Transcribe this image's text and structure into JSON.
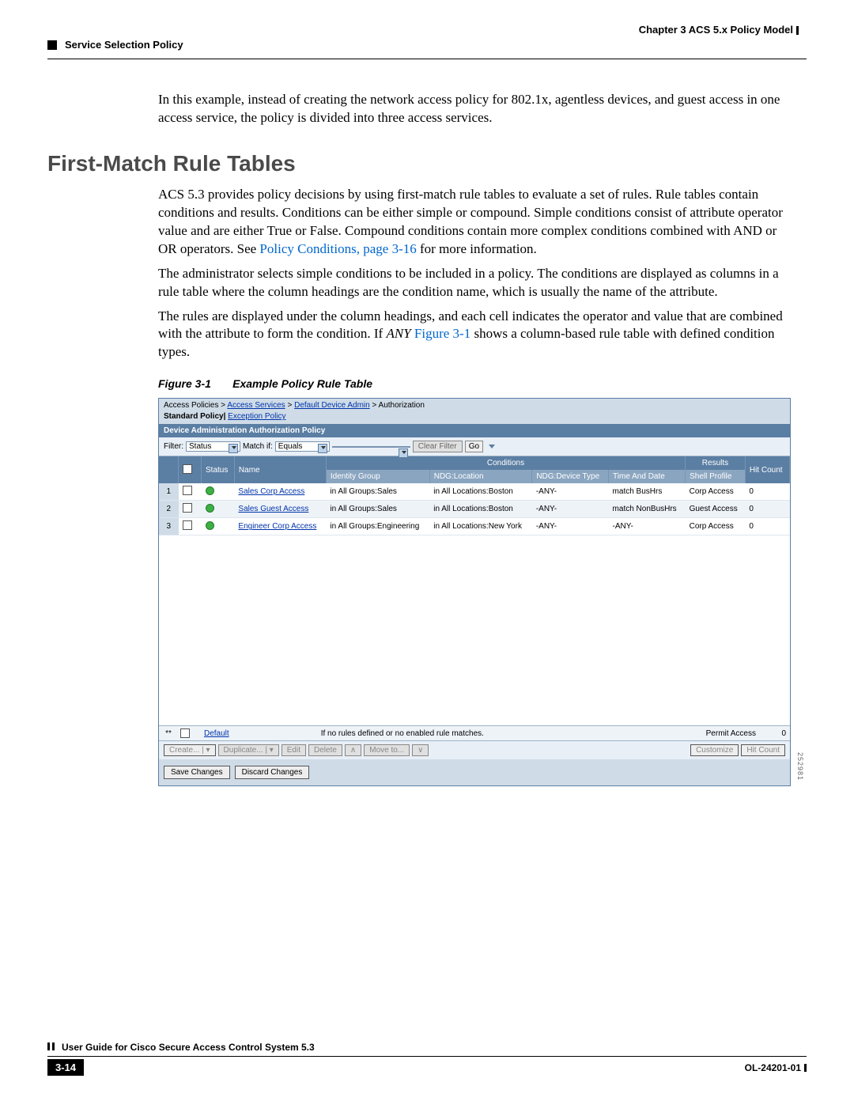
{
  "header": {
    "chapter": "Chapter 3    ACS 5.x Policy Model",
    "section": "Service Selection Policy"
  },
  "body": {
    "intro_para": "In this example, instead of creating the network access policy for 802.1x, agentless devices, and guest access in one access service, the policy is divided into three access services.",
    "h2": "First-Match Rule Tables",
    "p1a": "ACS 5.3 provides policy decisions by using first-match rule tables to evaluate a set of rules. Rule tables contain conditions and results. Conditions can be either simple or compound. Simple conditions consist of attribute operator value and are either True or False. Compound conditions contain more complex conditions combined with AND or OR operators. See ",
    "p1_link": "Policy Conditions, page 3-16",
    "p1b": " for more information.",
    "p2": "The administrator selects simple conditions to be included in a policy. The conditions are displayed as columns in a rule table where the column headings are the condition name, which is usually the name of the attribute.",
    "p3a": "The rules are displayed under the column headings, and each cell indicates the operator and value that are combined with the attribute to form the condition. If ",
    "p3_any": "ANY",
    "p3_link": " Figure 3-1",
    "p3b": " shows a column-based rule table with defined condition types.",
    "fig_caption_num": "Figure 3-1",
    "fig_caption_txt": "Example Policy Rule Table"
  },
  "shot": {
    "crumb_plain": "Access Policies >",
    "crumb_l1": "Access Services",
    "crumb_sep": " > ",
    "crumb_l2": "Default Device Admin",
    "crumb_tail": " > Authorization",
    "tabs_a": "Standard Policy",
    "tabs_sep": "| ",
    "tabs_b": "Exception Policy",
    "strip": "Device Administration Authorization Policy",
    "filter_label": "Filter:",
    "filter_val": "Status",
    "match_label": "Match if:",
    "match_val": "Equals",
    "clear_btn": "Clear Filter",
    "go_btn": "Go",
    "th": {
      "status": "Status",
      "name": "Name",
      "conditions": "Conditions",
      "idgroup": "Identity Group",
      "ndgloc": "NDG:Location",
      "ndgdev": "NDG:Device Type",
      "timedate": "Time And Date",
      "results": "Results",
      "shell": "Shell Profile",
      "hit": "Hit Count"
    },
    "rows": [
      {
        "n": "1",
        "name": "Sales Corp Access",
        "ig": "in All Groups:Sales",
        "loc": "in All Locations:Boston",
        "dev": "-ANY-",
        "td": "match BusHrs",
        "shell": "Corp Access",
        "hit": "0"
      },
      {
        "n": "2",
        "name": "Sales Guest Access",
        "ig": "in All Groups:Sales",
        "loc": "in All Locations:Boston",
        "dev": "-ANY-",
        "td": "match NonBusHrs",
        "shell": "Guest Access",
        "hit": "0"
      },
      {
        "n": "3",
        "name": "Engineer Corp Access",
        "ig": "in All Groups:Engineering",
        "loc": "in All Locations:New York",
        "dev": "-ANY-",
        "td": "-ANY-",
        "shell": "Corp Access",
        "hit": "0"
      }
    ],
    "default_link": "Default",
    "default_msg": "If no rules defined or no enabled rule matches.",
    "default_result": "Permit Access",
    "default_hit": "0",
    "tb": {
      "create": "Create...",
      "dup": "Duplicate...",
      "edit": "Edit",
      "del": "Delete",
      "move": "Move to...",
      "cust": "Customize",
      "hit": "Hit Count"
    },
    "save": "Save Changes",
    "discard": "Discard Changes",
    "side_num": "252981"
  },
  "footer": {
    "guide": "User Guide for Cisco Secure Access Control System 5.3",
    "page": "3-14",
    "doc": "OL-24201-01"
  }
}
